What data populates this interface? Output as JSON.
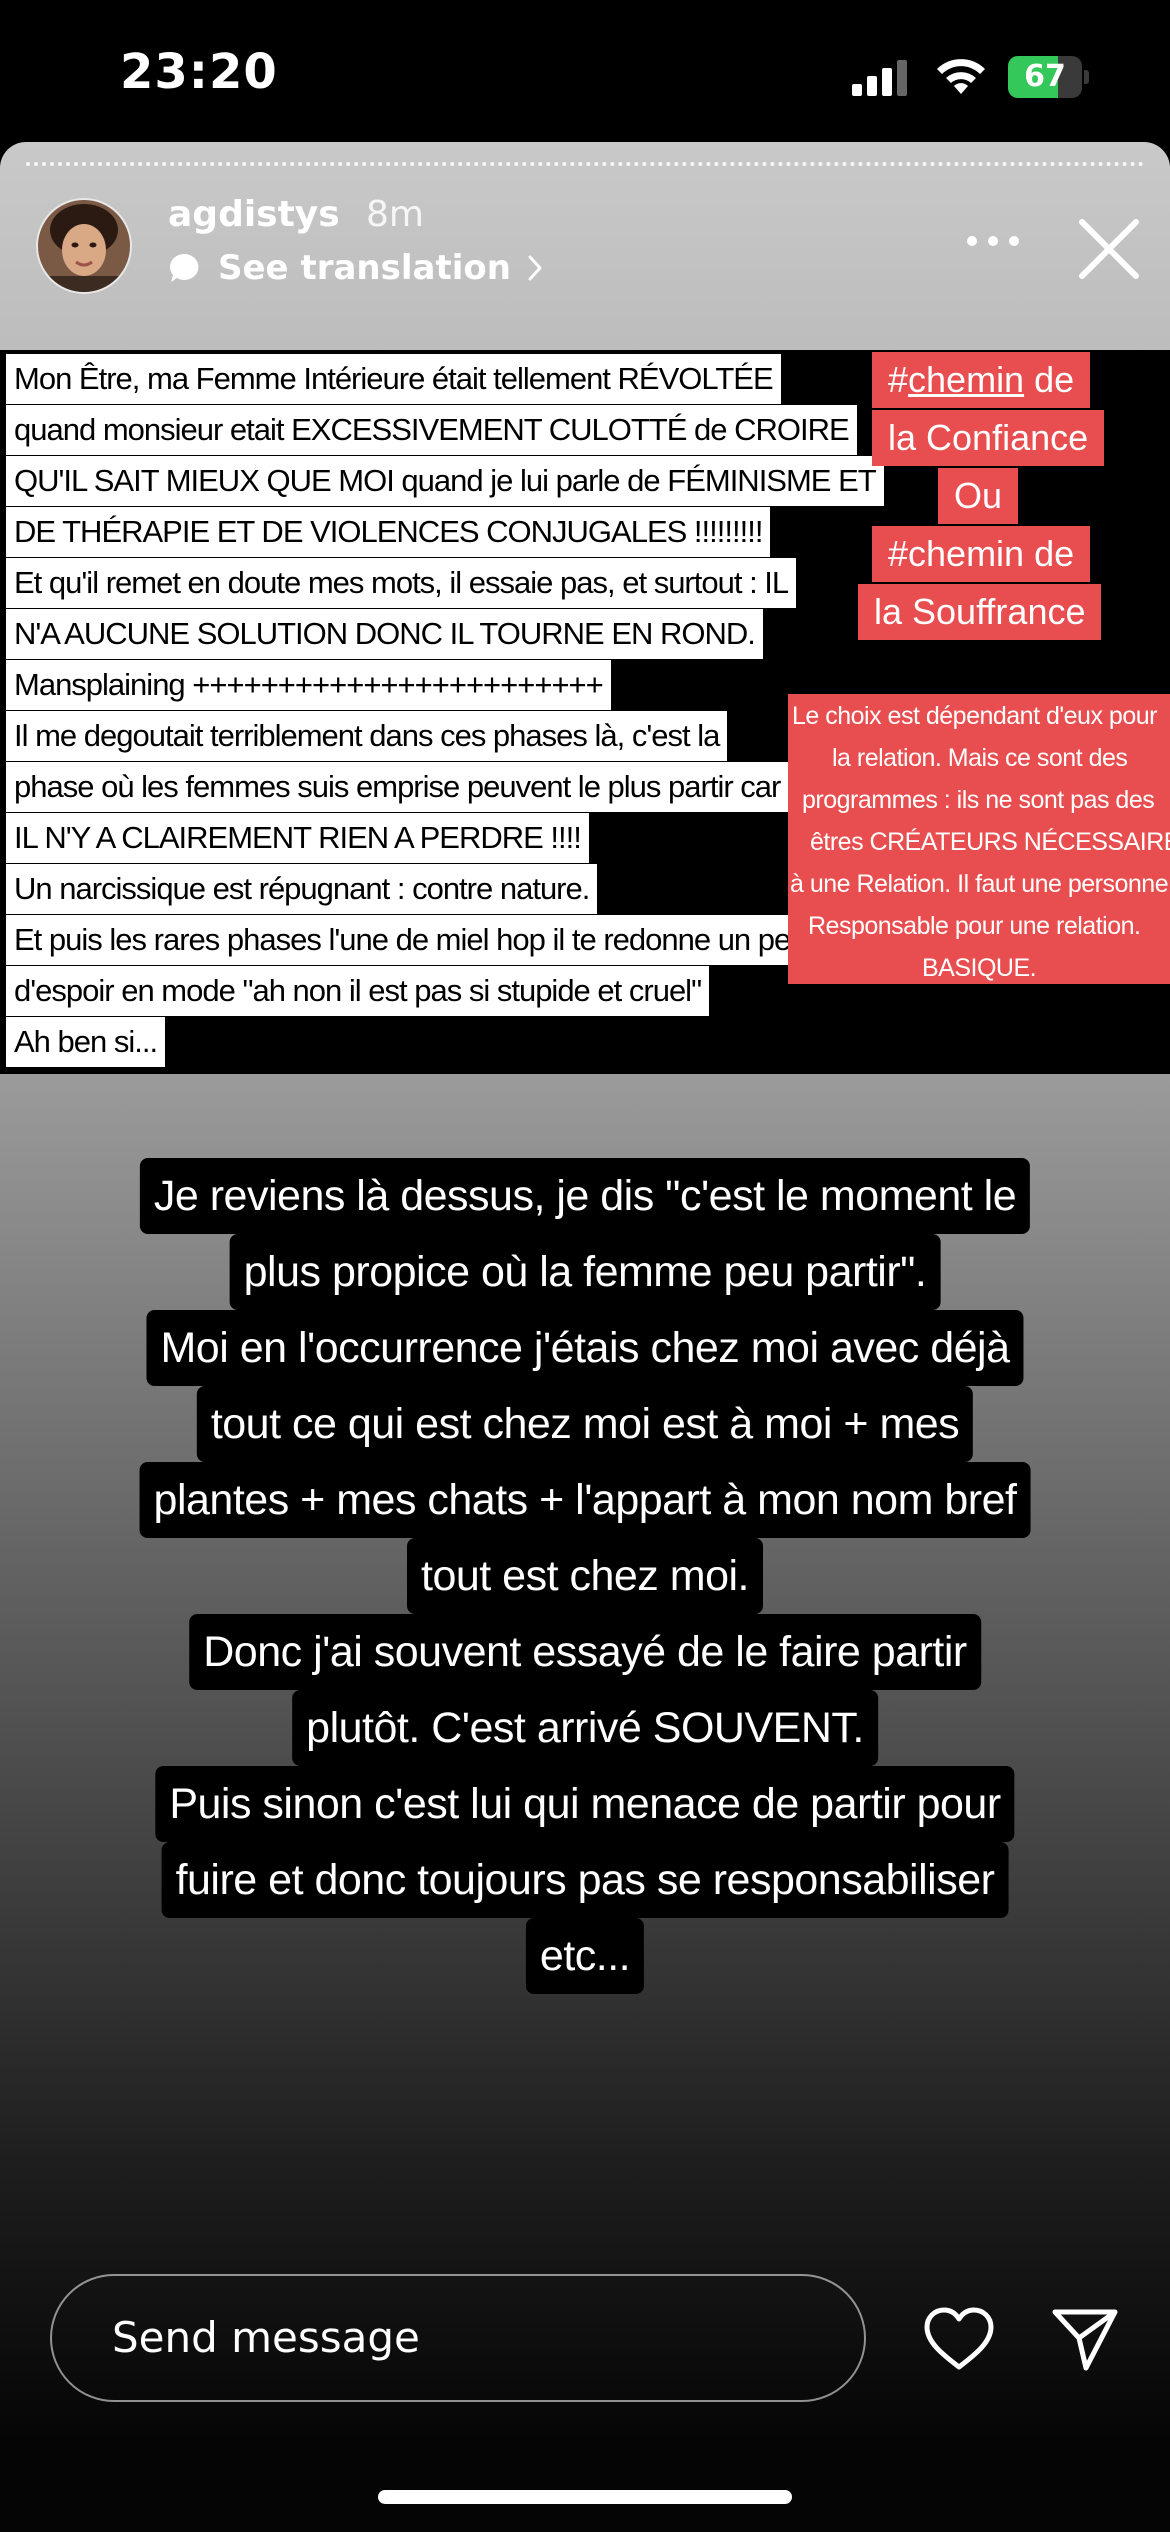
{
  "status_bar": {
    "time": "23:20",
    "battery": "67",
    "battery_level": 0.67,
    "battery_color": "#34c759"
  },
  "story": {
    "username": "agdistys",
    "timestamp": "8m",
    "translate_label": "See translation",
    "icons": [
      "avatar",
      "speech-bubble-icon",
      "chevron-right-icon",
      "more-icon",
      "close-icon"
    ]
  },
  "screenshot": {
    "note_lines": [
      "Mon Être, ma Femme Intérieure  était tellement RÉVOLTÉE",
      "quand monsieur etait EXCESSIVEMENT CULOTTÉ de CROIRE",
      "QU'IL SAIT MIEUX QUE MOI quand je lui parle de FÉMINISME ET",
      "DE THÉRAPIE ET DE VIOLENCES CONJUGALES !!!!!!!!!",
      "Et qu'il remet en doute mes mots, il essaie pas, et surtout : IL",
      "N'A AUCUNE SOLUTION DONC IL TOURNE EN ROND.",
      "Mansplaining ++++++++++++++++++++++++",
      "Il me degoutait terriblement dans ces phases là, c'est la",
      "phase où les femmes suis emprise peuvent le plus partir car",
      "IL N'Y A CLAIREMENT RIEN A PERDRE !!!!",
      "Un narcissique est répugnant : contre nature.",
      "Et puis les rares phases l'une de miel hop il te redonne un peu",
      "d'espoir en mode \"ah non il est pas si stupide et  cruel\"",
      "Ah ben si..."
    ],
    "tag_lines": [
      {
        "hash": "#",
        "link": "chemin",
        "rest": " de"
      },
      {
        "hash": "",
        "link": "",
        "rest": "la Confiance"
      },
      {
        "hash": "",
        "link": "",
        "rest": "Ou"
      },
      {
        "hash": "#chemin de",
        "link": "",
        "rest": ""
      },
      {
        "hash": "",
        "link": "",
        "rest": "la Souffrance"
      }
    ],
    "red_lines": [
      "Le choix est dépendant d'eux pour",
      "la relation. Mais ce sont des",
      "programmes : ils ne sont pas des",
      "êtres CRÉATEURS NÉCESSAIRE",
      "à une Relation. Il faut une personne",
      "Responsable pour une relation.",
      "BASIQUE."
    ],
    "colors": {
      "tag_red": "#e84e4f"
    }
  },
  "caption_lines": [
    "Je reviens là dessus, je dis \"c'est le moment le",
    "plus propice où la femme peu partir\".",
    "Moi en l'occurrence j'étais chez moi avec déjà",
    "tout ce qui est chez moi est à moi + mes",
    "plantes + mes chats + l'appart à mon nom bref",
    "tout est chez moi.",
    "Donc j'ai souvent essayé de le faire partir",
    "plutôt. C'est arrivé SOUVENT.",
    "Puis sinon c'est lui qui menace de partir pour",
    "fuire et donc toujours pas se responsabiliser",
    "etc..."
  ],
  "bottom_bar": {
    "message_placeholder": "Send message",
    "icons": [
      "heart-icon",
      "send-icon"
    ]
  }
}
